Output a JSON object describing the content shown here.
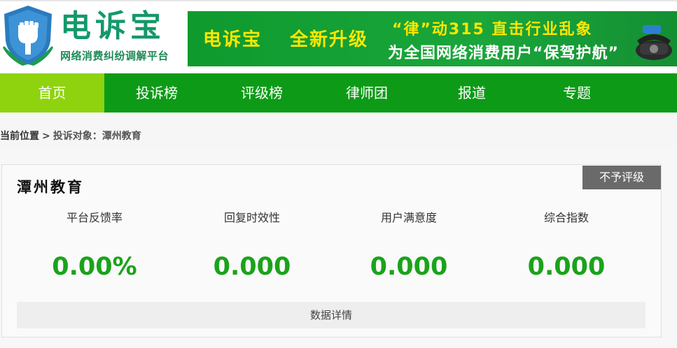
{
  "header": {
    "logo_title": "电诉宝",
    "logo_subtitle": "网络消费纠纷调解平台",
    "banner": {
      "brand": "电诉宝",
      "upgrade": "全新升级",
      "line1": "“律”动315 直击行业乱象",
      "line2": "为全国网络消费用户“保驾护航”"
    }
  },
  "nav": {
    "items": [
      {
        "label": "首页",
        "active": true
      },
      {
        "label": "投诉榜"
      },
      {
        "label": "评级榜"
      },
      {
        "label": "律师团"
      },
      {
        "label": "报道"
      },
      {
        "label": "专题"
      }
    ]
  },
  "breadcrumb": {
    "current": "当前位置",
    "separator": ">",
    "path": "投诉对象：潭州教育"
  },
  "company": {
    "name": "潭州教育",
    "rating_badge": "不予评级",
    "stats": [
      {
        "label": "平台反馈率",
        "value": "0.00%"
      },
      {
        "label": "回复时效性",
        "value": "0.000"
      },
      {
        "label": "用户满意度",
        "value": "0.000"
      },
      {
        "label": "综合指数",
        "value": "0.000"
      }
    ],
    "details_label": "数据详情"
  },
  "colors": {
    "nav_green": "#0d9b17",
    "nav_active": "#8fd30f",
    "stat_green": "#1aa31a",
    "badge_gray": "#6a6a6a"
  }
}
